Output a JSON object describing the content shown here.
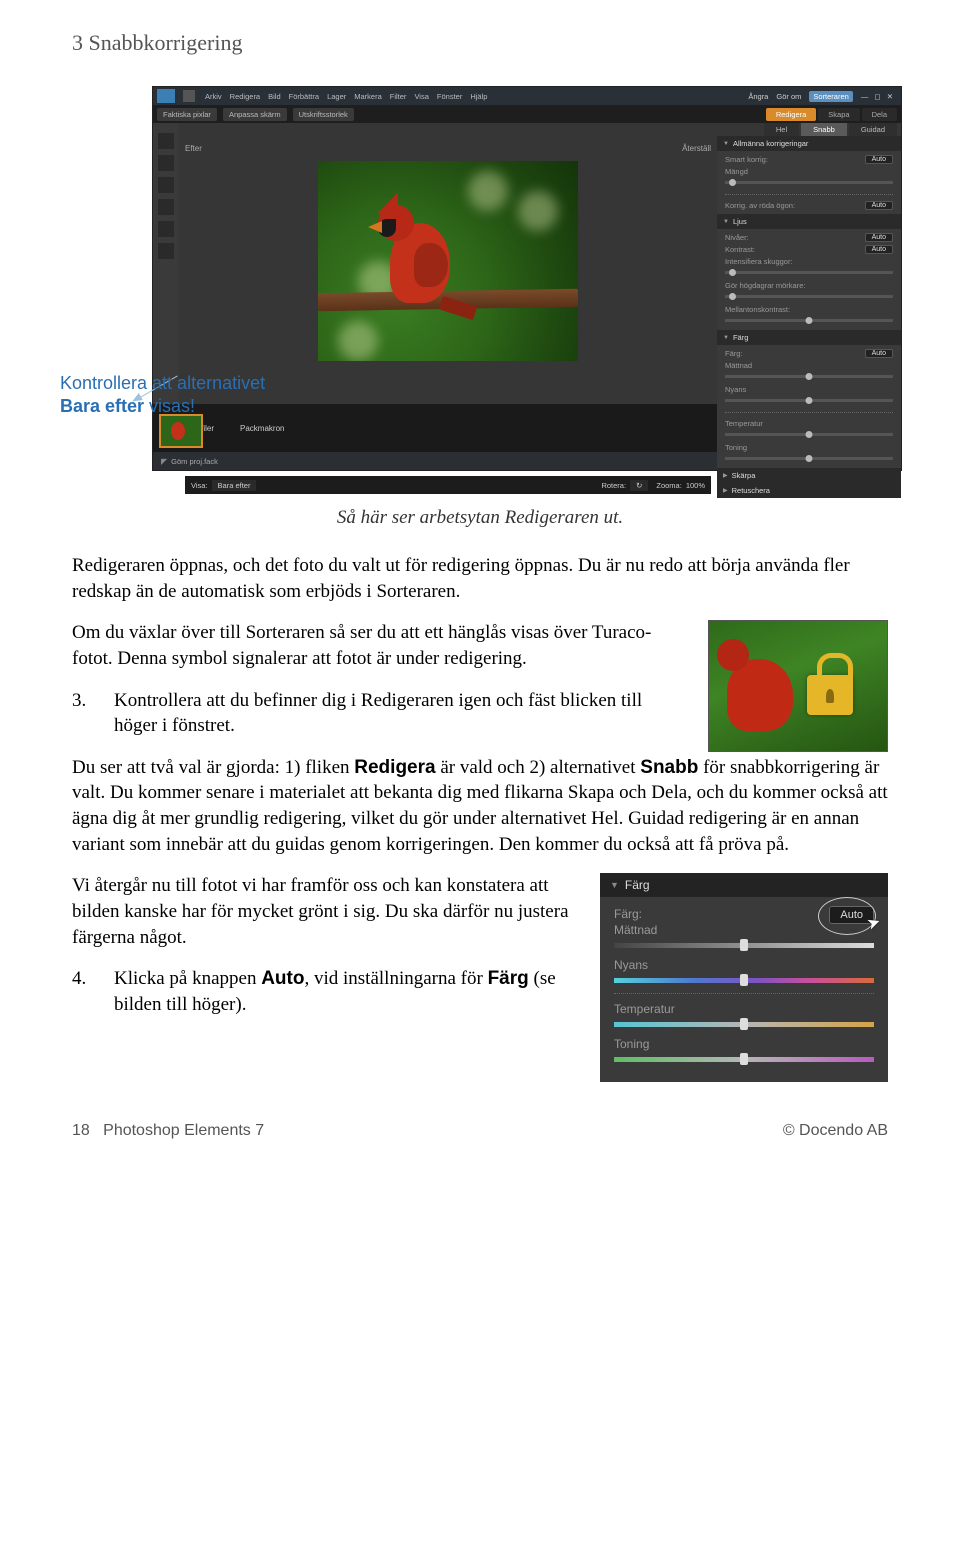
{
  "chapter": "3 Snabbkorrigering",
  "callout": {
    "line1": "Kontrollera att alternativet",
    "line2a": "Bara efter",
    "line2b": " visas!"
  },
  "caption": "Så här ser arbetsytan Redigeraren ut.",
  "para1": "Redigeraren öppnas, och det foto du valt ut för redigering öppnas. Du är nu redo att börja använda fler redskap än de automatisk som erbjöds i Sorteraren.",
  "para2": "Om du växlar över till Sorteraren så ser du att ett hänglås visas över Turaco-fotot. Denna symbol signalerar att fotot är under redigering.",
  "item3": {
    "num": "3.",
    "text": "Kontrollera att du befinner dig i Redigeraren igen och fäst blicken till höger i fönstret."
  },
  "para3a": "Du ser att två val är gjorda: 1) fliken ",
  "para3b": " är vald och 2) alternativet ",
  "para3c": " för snabbkorrigering är valt. Du kommer senare i materialet att bekanta dig med flikarna Skapa och Dela, och du kommer också att ägna dig åt mer grundlig redigering, vilket du gör under alternativet Hel. Guidad redigering är en annan variant som innebär att du guidas genom korrigeringen. Den kommer du också att få pröva på.",
  "bold_redigera": "Redigera",
  "bold_snabb": "Snabb",
  "para4": "Vi återgår nu till fotot vi har framför oss och kan konstatera att bilden kanske har för mycket grönt i sig. Du ska därför nu justera färgerna något.",
  "item4": {
    "num": "4.",
    "texta": "Klicka på knappen ",
    "bold": "Auto",
    "textb": ", vid inställningarna för ",
    "bold2": "Färg",
    "textc": " (se bilden till höger)."
  },
  "footer": {
    "page": "18",
    "title": "Photoshop Elements 7",
    "copy": "© Docendo AB"
  },
  "ss": {
    "menu": [
      "Arkiv",
      "Redigera",
      "Bild",
      "Förbättra",
      "Lager",
      "Markera",
      "Filter",
      "Visa",
      "Fönster",
      "Hjälp"
    ],
    "undo": "Ångra",
    "redo": "Gör om",
    "sort": "Sorteraren",
    "tabs": [
      "Faktiska pixlar",
      "Anpassa skärm",
      "Utskriftsstorlek"
    ],
    "rtabs": [
      "Redigera",
      "Skapa",
      "Dela"
    ],
    "subtabs": [
      "Hel",
      "Snabb",
      "Guidad"
    ],
    "efter": "Efter",
    "reset": "Återställ",
    "bottom": {
      "visa": "Visa:",
      "visa_v": "Bara efter",
      "rot": "Rotera:",
      "zoom": "Zooma:",
      "zoom_v": "100%"
    },
    "panel": {
      "general": "Allmänna korrigeringar",
      "smart": "Smart korrig:",
      "auto": "Auto",
      "amount": "Mängd",
      "redeye": "Korrig. av röda ögon:",
      "light": "Ljus",
      "brighten": "Intensifiera skuggor:",
      "darken": "Gör högdagrar mörkare:",
      "mid": "Mellantonskontrast:",
      "contrast": "Kontrast:",
      "levels": "Nivåer:",
      "color": "Färg",
      "farg": "Färg:",
      "satt": "Mättnad",
      "nyans": "Nyans",
      "temp": "Temperatur",
      "toning": "Toning",
      "sharp": "Skärpa",
      "retouch": "Retuschera"
    },
    "open": "Visa öppna filer",
    "bin": "Packmakron",
    "status": "Göm proj.fack"
  },
  "farg_panel": {
    "title": "Färg",
    "farg": "Färg:",
    "auto": "Auto",
    "satt": "Mättnad",
    "nyans": "Nyans",
    "temp": "Temperatur",
    "toning": "Toning"
  }
}
